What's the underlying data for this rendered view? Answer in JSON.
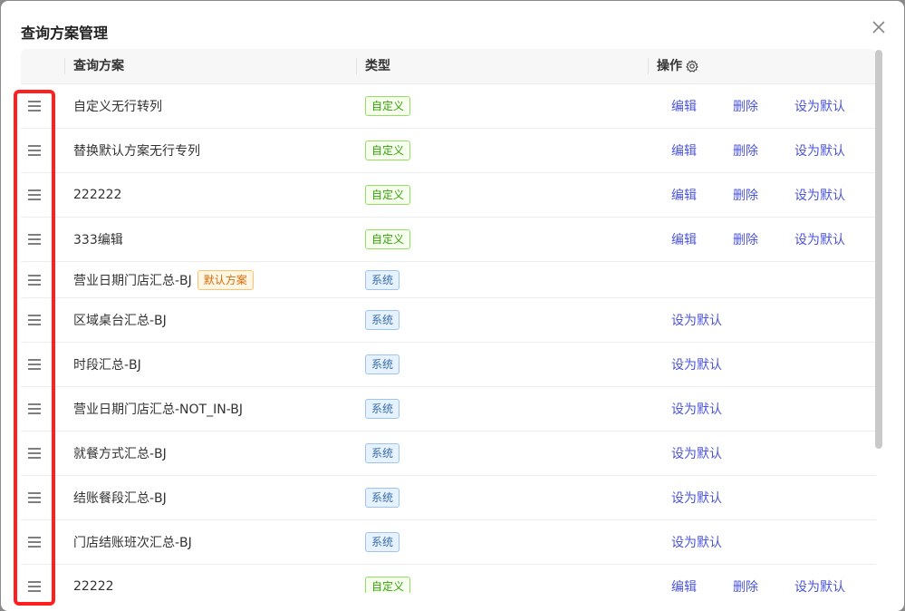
{
  "dialog": {
    "title": "查询方案管理",
    "close_icon": "close-icon"
  },
  "table": {
    "headers": {
      "drag": "",
      "name": "查询方案",
      "type": "类型",
      "actions": "操作"
    },
    "action_labels": {
      "edit": "编辑",
      "delete": "删除",
      "set_default": "设为默认"
    },
    "rows": [
      {
        "name": "自定义无行转列",
        "type": "自定义",
        "type_kind": "custom",
        "default_tag": "",
        "actions": [
          "edit",
          "delete",
          "set_default"
        ]
      },
      {
        "name": "替换默认方案无行专列",
        "type": "自定义",
        "type_kind": "custom",
        "default_tag": "",
        "actions": [
          "edit",
          "delete",
          "set_default"
        ]
      },
      {
        "name": "222222",
        "type": "自定义",
        "type_kind": "custom",
        "default_tag": "",
        "actions": [
          "edit",
          "delete",
          "set_default"
        ]
      },
      {
        "name": "333编辑",
        "type": "自定义",
        "type_kind": "custom",
        "default_tag": "",
        "actions": [
          "edit",
          "delete",
          "set_default"
        ]
      },
      {
        "name": "营业日期门店汇总-BJ",
        "type": "系统",
        "type_kind": "system",
        "default_tag": "默认方案",
        "actions": []
      },
      {
        "name": "区域桌台汇总-BJ",
        "type": "系统",
        "type_kind": "system",
        "default_tag": "",
        "actions": [
          "set_default"
        ]
      },
      {
        "name": "时段汇总-BJ",
        "type": "系统",
        "type_kind": "system",
        "default_tag": "",
        "actions": [
          "set_default"
        ]
      },
      {
        "name": "营业日期门店汇总-NOT_IN-BJ",
        "type": "系统",
        "type_kind": "system",
        "default_tag": "",
        "actions": [
          "set_default"
        ]
      },
      {
        "name": "就餐方式汇总-BJ",
        "type": "系统",
        "type_kind": "system",
        "default_tag": "",
        "actions": [
          "set_default"
        ]
      },
      {
        "name": "结账餐段汇总-BJ",
        "type": "系统",
        "type_kind": "system",
        "default_tag": "",
        "actions": [
          "set_default"
        ]
      },
      {
        "name": "门店结账班次汇总-BJ",
        "type": "系统",
        "type_kind": "system",
        "default_tag": "",
        "actions": [
          "set_default"
        ]
      },
      {
        "name": "22222",
        "type": "自定义",
        "type_kind": "custom",
        "default_tag": "",
        "actions": [
          "edit",
          "delete",
          "set_default"
        ]
      }
    ]
  },
  "icons": {
    "drag_handle": "drag-handle-icon",
    "settings": "gear-icon"
  },
  "colors": {
    "link": "#4c55d6",
    "highlight": "#ff1f1f"
  }
}
